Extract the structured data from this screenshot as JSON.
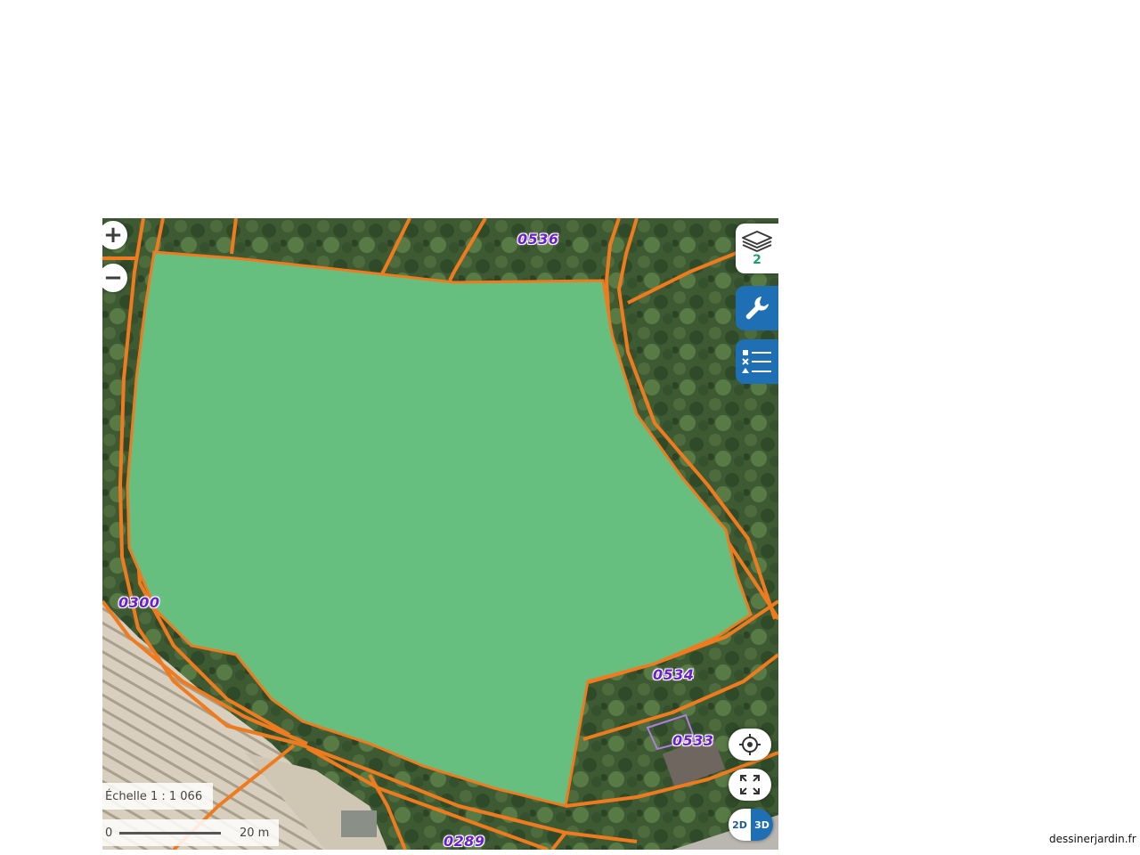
{
  "map": {
    "parcels": [
      {
        "id": "0536",
        "label": "0536"
      },
      {
        "id": "0300",
        "label": "0300"
      },
      {
        "id": "0534",
        "label": "0534"
      },
      {
        "id": "0533",
        "label": "0533"
      },
      {
        "id": "0289",
        "label": "0289"
      }
    ],
    "parcel_label_color": "#6a1fd0",
    "boundary_color": "#f07b1e",
    "highlight_fill": "#66bf7f",
    "imagery": "aerial"
  },
  "controls": {
    "zoom_in_label": "+",
    "zoom_out_label": "−",
    "layers_icon": "layers-icon",
    "layers_count": "2",
    "tools_icon": "wrench-icon",
    "legend_icon": "legend-list-icon",
    "locate_icon": "crosshair-locate-icon",
    "fullscreen_icon": "fullscreen-expand-icon",
    "toggle_2d_label": "2D",
    "toggle_3d_label": "3D",
    "accent_color": "#1e6fb4"
  },
  "scale": {
    "text": "Échelle 1 : 1 066",
    "bar_start": "0",
    "bar_end": "20 m"
  },
  "credit": "dessinerjardin.fr"
}
